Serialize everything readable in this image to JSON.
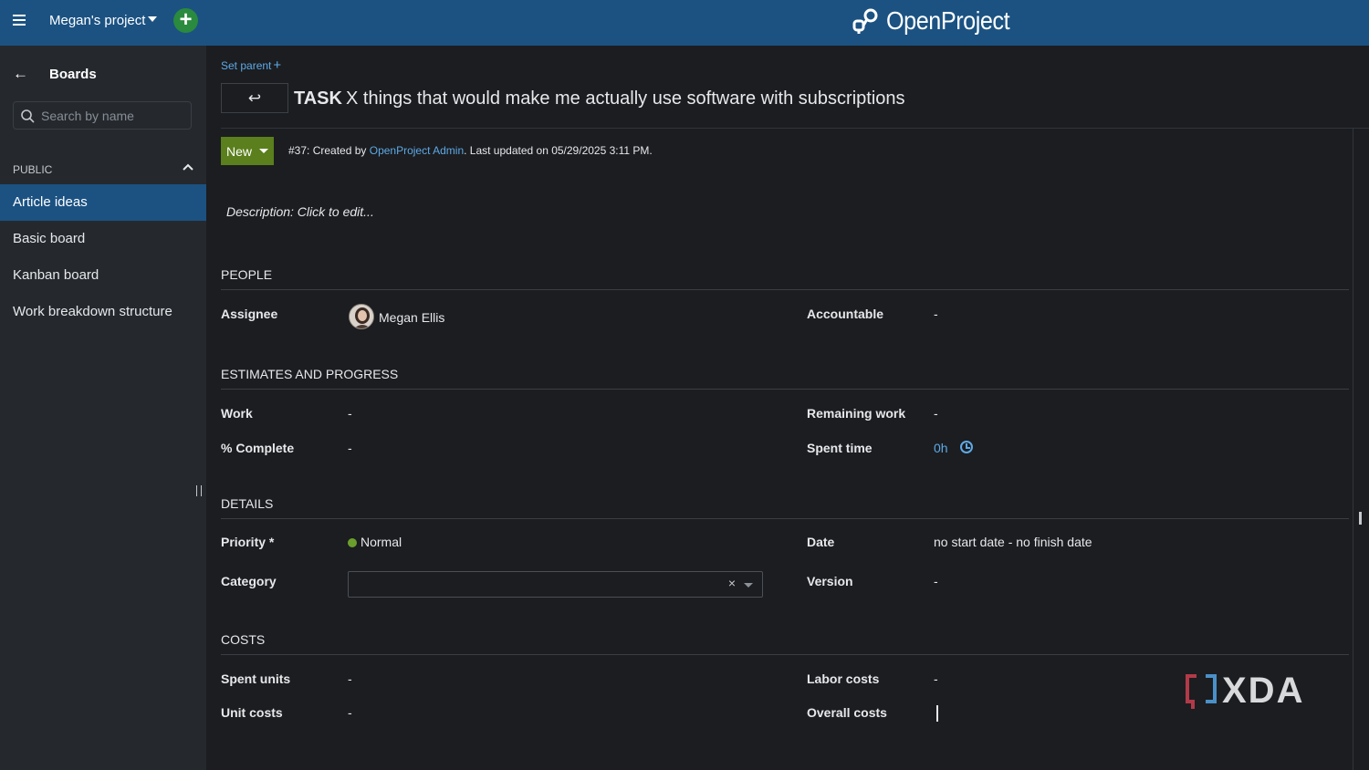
{
  "header": {
    "project_name": "Megan's project",
    "logo_text": "OpenProject",
    "brand_color": "#1b5282",
    "add_button_color": "#2a8a3e"
  },
  "sidebar": {
    "back_label": "Boards",
    "search_placeholder": "Search by name",
    "section_label": "PUBLIC",
    "items": [
      {
        "label": "Article ideas",
        "active": true
      },
      {
        "label": "Basic board",
        "active": false
      },
      {
        "label": "Kanban board",
        "active": false
      },
      {
        "label": "Work breakdown structure",
        "active": false
      }
    ]
  },
  "work_package": {
    "set_parent_label": "Set parent",
    "type": "TASK",
    "subject": "X things that would make me actually use software with subscriptions",
    "status": "New",
    "status_color": "#5a7f1c",
    "meta_prefix": "#37: Created by ",
    "meta_author": "OpenProject Admin",
    "meta_suffix": ". Last updated on 05/29/2025 3:11 PM.",
    "description_placeholder": "Description: Click to edit..."
  },
  "sections": {
    "people": {
      "title": "PEOPLE",
      "assignee_label": "Assignee",
      "assignee_value": "Megan Ellis",
      "accountable_label": "Accountable",
      "accountable_value": "-"
    },
    "estimates": {
      "title": "ESTIMATES AND PROGRESS",
      "work_label": "Work",
      "work_value": "-",
      "remaining_label": "Remaining work",
      "remaining_value": "-",
      "complete_label": "% Complete",
      "complete_value": "-",
      "spent_label": "Spent time",
      "spent_value": "0h"
    },
    "details": {
      "title": "DETAILS",
      "priority_label": "Priority *",
      "priority_value": "Normal",
      "date_label": "Date",
      "date_value": "no start date - no finish date",
      "category_label": "Category",
      "category_clear": "×",
      "version_label": "Version",
      "version_value": "-"
    },
    "costs": {
      "title": "COSTS",
      "spent_units_label": "Spent units",
      "spent_units_value": "-",
      "labor_label": "Labor costs",
      "labor_value": "-",
      "unit_costs_label": "Unit costs",
      "unit_costs_value": "-",
      "overall_label": "Overall costs"
    }
  },
  "watermark": {
    "text": "XDA"
  }
}
